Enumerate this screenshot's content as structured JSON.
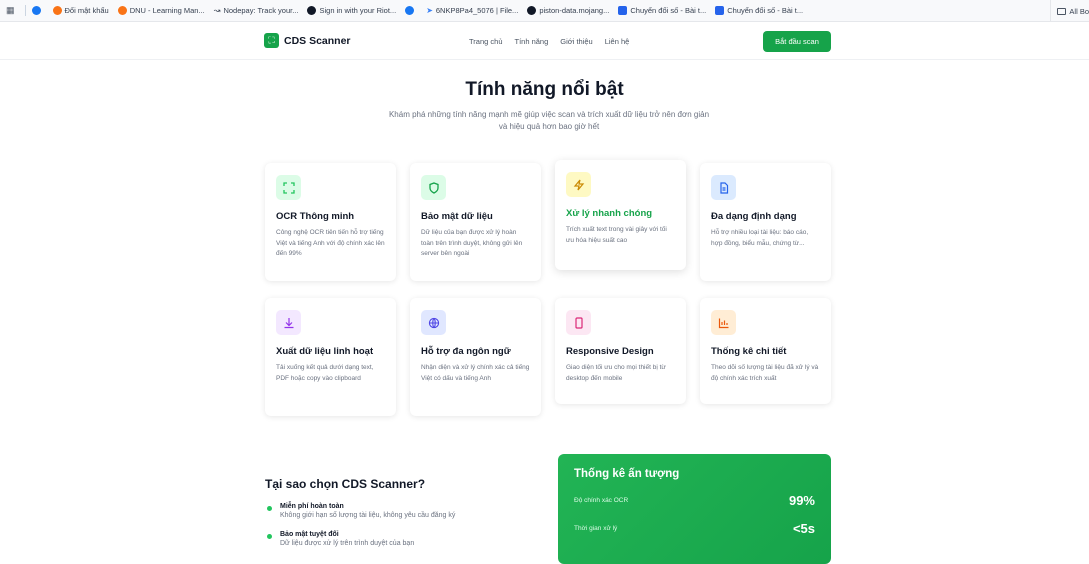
{
  "bookmarks": {
    "items": [
      {
        "label": "Đổi mật khẩu",
        "color": "#f97316"
      },
      {
        "label": "DNU - Learning Man...",
        "color": "#f97316"
      },
      {
        "label": "Nodepay: Track your...",
        "color": "#6b7280"
      },
      {
        "label": "Sign in with your Riot...",
        "color": "#111827"
      },
      {
        "label": "",
        "color": "#1877f2"
      },
      {
        "label": "6NKP8Pa4_5076 | File...",
        "color": "#3b82f6"
      },
      {
        "label": "piston-data.mojang...",
        "color": "#111827"
      },
      {
        "label": "Chuyển đổi số - Bài t...",
        "color": "#2563eb"
      },
      {
        "label": "Chuyển đổi số - Bài t...",
        "color": "#2563eb"
      }
    ],
    "all_label": "All Bo"
  },
  "navbar": {
    "brand": "CDS Scanner",
    "links": [
      "Trang chủ",
      "Tính năng",
      "Giới thiệu",
      "Liên hệ"
    ],
    "cta": "Bắt đầu scan"
  },
  "hero": {
    "title": "Tính năng nổi bật",
    "subtitle_line1": "Khám phá những tính năng mạnh mẽ giúp việc scan và trích xuất dữ liệu trở nên đơn giản",
    "subtitle_line2": "và hiệu quả hơn bao giờ hết"
  },
  "features": [
    {
      "title": "OCR Thông minh",
      "desc": "Công nghệ OCR tiên tiến hỗ trợ tiếng Việt và tiếng Anh với độ chính xác lên đến 99%",
      "icon": "scan-icon",
      "color": "#22c55e",
      "bg": "#dcfce7"
    },
    {
      "title": "Bảo mật dữ liệu",
      "desc": "Dữ liệu của bạn được xử lý hoàn toàn trên trình duyệt, không gửi lên server bên ngoài",
      "icon": "shield-icon",
      "color": "#16a34a",
      "bg": "#dcfce7"
    },
    {
      "title": "Xử lý nhanh chóng",
      "desc": "Trích xuất text trong vài giây với tối ưu hóa hiệu suất cao",
      "icon": "lightning-icon",
      "color": "#ca8a04",
      "bg": "#fef9c3"
    },
    {
      "title": "Đa dạng định dạng",
      "desc": "Hỗ trợ nhiều loại tài liệu: báo cáo, hợp đồng, biểu mẫu, chứng từ...",
      "icon": "document-icon",
      "color": "#2563eb",
      "bg": "#dbeafe"
    },
    {
      "title": "Xuất dữ liệu linh hoạt",
      "desc": "Tải xuống kết quả dưới dạng text, PDF hoặc copy vào clipboard",
      "icon": "download-icon",
      "color": "#9333ea",
      "bg": "#f3e8ff"
    },
    {
      "title": "Hỗ trợ đa ngôn ngữ",
      "desc": "Nhận diện và xử lý chính xác cả tiếng Việt có dấu và tiếng Anh",
      "icon": "globe-icon",
      "color": "#4f46e5",
      "bg": "#e0e7ff"
    },
    {
      "title": "Responsive Design",
      "desc": "Giao diện tối ưu cho mọi thiết bị từ desktop đến mobile",
      "icon": "mobile-icon",
      "color": "#db2777",
      "bg": "#fce7f3"
    },
    {
      "title": "Thống kê chi tiết",
      "desc": "Theo dõi số lượng tài liệu đã xử lý và độ chính xác trích xuất",
      "icon": "bar-chart-icon",
      "color": "#ea580c",
      "bg": "#ffedd5"
    }
  ],
  "why": {
    "title": "Tại sao chọn CDS Scanner?",
    "items": [
      {
        "title": "Miễn phí hoàn toàn",
        "desc": "Không giới hạn số lượng tài liệu, không yêu cầu đăng ký"
      },
      {
        "title": "Bảo mật tuyệt đối",
        "desc": "Dữ liệu được xử lý trên trình duyệt của bạn"
      }
    ]
  },
  "stats": {
    "title": "Thống kê ấn tượng",
    "rows": [
      {
        "label": "Độ chính xác OCR",
        "value": "99%"
      },
      {
        "label": "Thời gian xử lý",
        "value": "<5s"
      }
    ]
  }
}
